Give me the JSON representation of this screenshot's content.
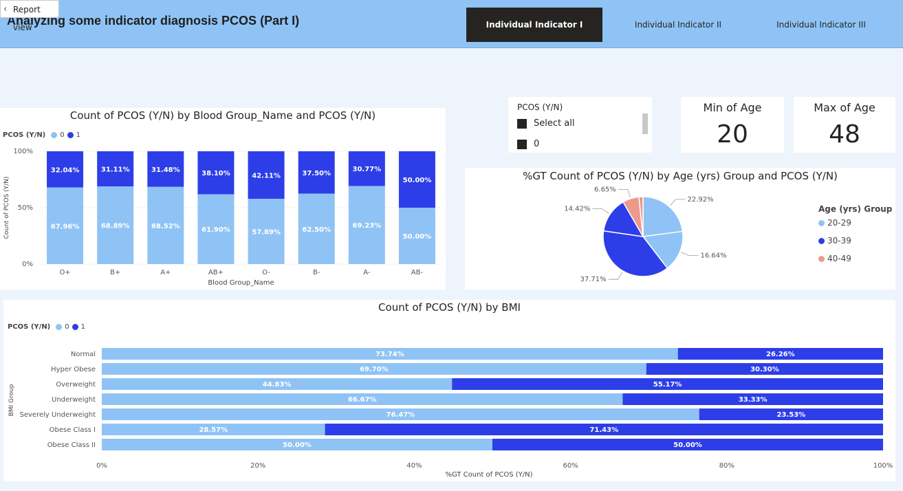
{
  "header": {
    "report_view": "Report view",
    "title": "Analyzing some indicator diagnosis PCOS (Part I)",
    "tabs": [
      {
        "label": "Individual Indicator I",
        "active": true
      },
      {
        "label": "Individual Indicator II",
        "active": false
      },
      {
        "label": "Individual Indicator III",
        "active": false
      }
    ]
  },
  "colors": {
    "light": "#8fc3f5",
    "dark": "#2d3ee8",
    "salmon": "#ed9a8c",
    "header": "#8fc3f5"
  },
  "slicer": {
    "title": "PCOS (Y/N)",
    "items": [
      "Select all",
      "0"
    ]
  },
  "kpis": [
    {
      "label": "Min of Age",
      "value": "20"
    },
    {
      "label": "Max of Age",
      "value": "48"
    }
  ],
  "chart_data": [
    {
      "type": "bar",
      "stacked": "100%",
      "title": "Count of PCOS (Y/N) by Blood Group_Name and PCOS (Y/N)",
      "legend_title": "PCOS (Y/N)",
      "legend_position": "top-left",
      "xlabel": "Blood Group_Name",
      "ylabel": "Count of PCOS (Y/N)",
      "yticks": [
        "0%",
        "50%",
        "100%"
      ],
      "categories": [
        "O+",
        "B+",
        "A+",
        "AB+",
        "O-",
        "B-",
        "A-",
        "AB-"
      ],
      "series": [
        {
          "name": "0",
          "values": [
            67.96,
            68.89,
            68.52,
            61.9,
            57.89,
            62.5,
            69.23,
            50.0
          ],
          "labels": [
            "67.96%",
            "68.89%",
            "68.52%",
            "61.90%",
            "57.89%",
            "62.50%",
            "69.23%",
            "50.00%"
          ]
        },
        {
          "name": "1",
          "values": [
            32.04,
            31.11,
            31.48,
            38.1,
            42.11,
            37.5,
            30.77,
            50.0
          ],
          "labels": [
            "32.04%",
            "31.11%",
            "31.48%",
            "38.10%",
            "42.11%",
            "37.50%",
            "30.77%",
            "50.00%"
          ]
        }
      ]
    },
    {
      "type": "pie",
      "title": "%GT Count of PCOS (Y/N) by Age (yrs) Group and PCOS (Y/N)",
      "legend_title": "Age (yrs) Group",
      "legend_position": "right",
      "legend": [
        "20-29",
        "30-39",
        "40-49"
      ],
      "slices": [
        {
          "group": "20-29",
          "value": 22.92,
          "label": "22.92%"
        },
        {
          "group": "20-29",
          "value": 16.64,
          "label": "16.64%"
        },
        {
          "group": "30-39",
          "value": 37.71,
          "label": "37.71%"
        },
        {
          "group": "30-39",
          "value": 14.42,
          "label": "14.42%"
        },
        {
          "group": "40-49",
          "value": 6.65,
          "label": "6.65%"
        },
        {
          "group": "40-49",
          "value": 1.66,
          "label": ""
        }
      ]
    },
    {
      "type": "bar",
      "orientation": "horizontal",
      "stacked": "100%",
      "title": "Count of PCOS (Y/N) by BMI",
      "legend_title": "PCOS (Y/N)",
      "legend_position": "top-left",
      "xlabel": "%GT Count of PCOS (Y/N)",
      "ylabel": "BMI Group",
      "xticks": [
        "0%",
        "20%",
        "40%",
        "60%",
        "80%",
        "100%"
      ],
      "categories": [
        "Normal",
        "Hyper Obese",
        "Overweight",
        "Underweight",
        "Severely Underweight",
        "Obese Class I",
        "Obese Class II"
      ],
      "series": [
        {
          "name": "0",
          "values": [
            73.74,
            69.7,
            44.83,
            66.67,
            76.47,
            28.57,
            50.0
          ],
          "labels": [
            "73.74%",
            "69.70%",
            "44.83%",
            "66.67%",
            "76.47%",
            "28.57%",
            "50.00%"
          ]
        },
        {
          "name": "1",
          "values": [
            26.26,
            30.3,
            55.17,
            33.33,
            23.53,
            71.43,
            50.0
          ],
          "labels": [
            "26.26%",
            "30.30%",
            "55.17%",
            "33.33%",
            "23.53%",
            "71.43%",
            "50.00%"
          ]
        }
      ]
    }
  ]
}
